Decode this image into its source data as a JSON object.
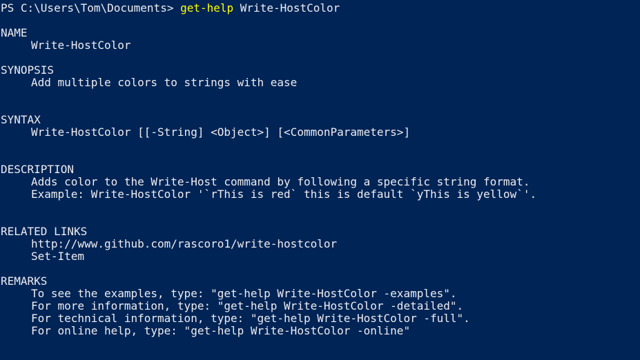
{
  "console": {
    "background": "#012456",
    "foreground": "#eeedf0",
    "command_color": "#ffff00",
    "prompt": {
      "path_text": "PS C:\\Users\\Tom\\Documents> ",
      "command": "get-help",
      "argument": " Write-HostColor"
    },
    "help": {
      "name_header": "NAME",
      "name_value": "Write-HostColor",
      "synopsis_header": "SYNOPSIS",
      "synopsis_value": "Add multiple colors to strings with ease",
      "syntax_header": "SYNTAX",
      "syntax_value": "Write-HostColor [[-String] <Object>] [<CommonParameters>]",
      "description_header": "DESCRIPTION",
      "description_lines": [
        "Adds color to the Write-Host command by following a specific string format.",
        "Example: Write-HostColor '`rThis is red` this is default `yThis is yellow`'."
      ],
      "related_header": "RELATED LINKS",
      "related_lines": [
        "http://www.github.com/rascoro1/write-hostcolor",
        "Set-Item"
      ],
      "remarks_header": "REMARKS",
      "remarks_lines": [
        "To see the examples, type: \"get-help Write-HostColor -examples\".",
        "For more information, type: \"get-help Write-HostColor -detailed\".",
        "For technical information, type: \"get-help Write-HostColor -full\".",
        "For online help, type: \"get-help Write-HostColor -online\""
      ]
    }
  }
}
